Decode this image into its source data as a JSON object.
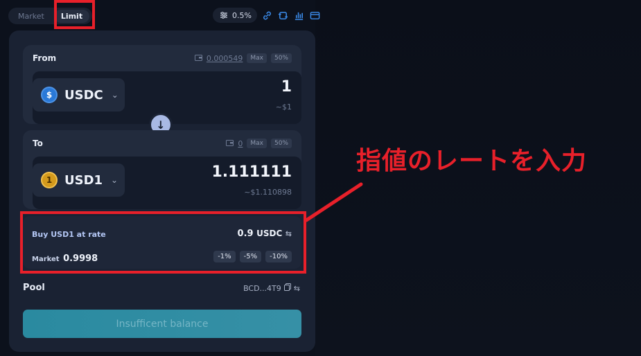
{
  "tabs": [
    {
      "label": "Market",
      "active": false
    },
    {
      "label": "Limit",
      "active": true
    }
  ],
  "slippage": "0.5%",
  "from": {
    "label": "From",
    "balance": "0.000549",
    "max_label": "Max",
    "half_label": "50%",
    "token": "USDC",
    "amount": "1",
    "usd_value": "~$1"
  },
  "to": {
    "label": "To",
    "balance": "0",
    "max_label": "Max",
    "half_label": "50%",
    "token": "USD1",
    "amount": "1.111111",
    "usd_value": "~$1.110898"
  },
  "rate": {
    "label": "Buy USD1 at rate",
    "value": "0.9",
    "unit": "USDC",
    "market_label": "Market",
    "market_value": "0.9998",
    "presets": [
      "-1%",
      "-5%",
      "-10%"
    ]
  },
  "pool": {
    "label": "Pool",
    "value": "BCD...4T9"
  },
  "cta_label": "Insufficent balance",
  "annotation": "指値のレートを入力",
  "colors": {
    "highlight": "#e8202a",
    "accent": "#3b8bea",
    "cta": "#2a8aa0"
  },
  "icons": [
    "settings-sliders-icon",
    "link-icon",
    "swap-route-icon",
    "bar-chart-icon",
    "card-icon",
    "wallet-icon",
    "arrow-down-icon",
    "copy-icon",
    "swap-arrows-icon",
    "chevron-down-icon"
  ]
}
